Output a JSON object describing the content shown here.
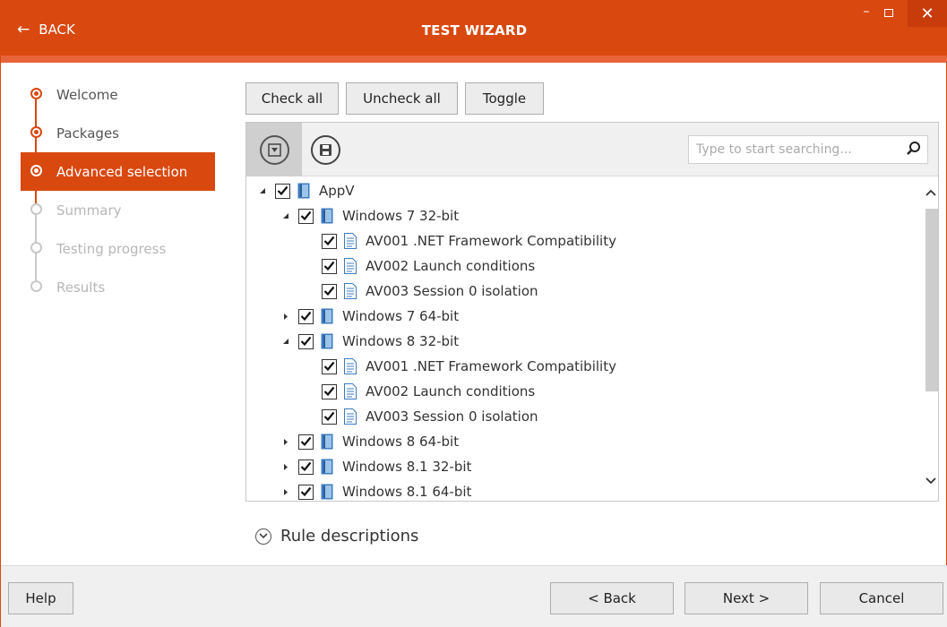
{
  "window": {
    "back_label": "BACK",
    "title": "TEST WIZARD",
    "minimize": "–",
    "close": "✕"
  },
  "steps": [
    {
      "label": "Welcome",
      "state": "done"
    },
    {
      "label": "Packages",
      "state": "done"
    },
    {
      "label": "Advanced selection",
      "state": "active"
    },
    {
      "label": "Summary",
      "state": "disabled"
    },
    {
      "label": "Testing progress",
      "state": "disabled"
    },
    {
      "label": "Results",
      "state": "disabled"
    }
  ],
  "actions": {
    "check_all": "Check all",
    "uncheck_all": "Uncheck all",
    "toggle": "Toggle"
  },
  "search": {
    "placeholder": "Type to start searching..."
  },
  "tree": [
    {
      "label": "AppV",
      "level": 0,
      "expander": "expanded",
      "checked": true,
      "icon": "package-icon"
    },
    {
      "label": "Windows 7 32-bit",
      "level": 1,
      "expander": "expanded",
      "checked": true,
      "icon": "package-icon"
    },
    {
      "label": "AV001 .NET Framework Compatibility",
      "level": 2,
      "expander": "none",
      "checked": true,
      "icon": "document-icon"
    },
    {
      "label": "AV002 Launch conditions",
      "level": 2,
      "expander": "none",
      "checked": true,
      "icon": "document-icon"
    },
    {
      "label": "AV003 Session 0 isolation",
      "level": 2,
      "expander": "none",
      "checked": true,
      "icon": "document-icon"
    },
    {
      "label": "Windows 7 64-bit",
      "level": 1,
      "expander": "collapsed",
      "checked": true,
      "icon": "package-icon"
    },
    {
      "label": "Windows 8 32-bit",
      "level": 1,
      "expander": "expanded",
      "checked": true,
      "icon": "package-icon"
    },
    {
      "label": "AV001 .NET Framework Compatibility",
      "level": 2,
      "expander": "none",
      "checked": true,
      "icon": "document-icon"
    },
    {
      "label": "AV002 Launch conditions",
      "level": 2,
      "expander": "none",
      "checked": true,
      "icon": "document-icon"
    },
    {
      "label": "AV003 Session 0 isolation",
      "level": 2,
      "expander": "none",
      "checked": true,
      "icon": "document-icon"
    },
    {
      "label": "Windows 8 64-bit",
      "level": 1,
      "expander": "collapsed",
      "checked": true,
      "icon": "package-icon"
    },
    {
      "label": "Windows 8.1 32-bit",
      "level": 1,
      "expander": "collapsed",
      "checked": true,
      "icon": "package-icon"
    },
    {
      "label": "Windows 8.1 64-bit",
      "level": 1,
      "expander": "collapsed",
      "checked": true,
      "icon": "package-icon"
    }
  ],
  "rule_descriptions": "Rule descriptions",
  "footer": {
    "help": "Help",
    "back": "< Back",
    "next": "Next >",
    "cancel": "Cancel"
  },
  "colors": {
    "accent": "#d9480f",
    "accent_light": "#e8643a",
    "disabled": "#b7b7b7"
  }
}
